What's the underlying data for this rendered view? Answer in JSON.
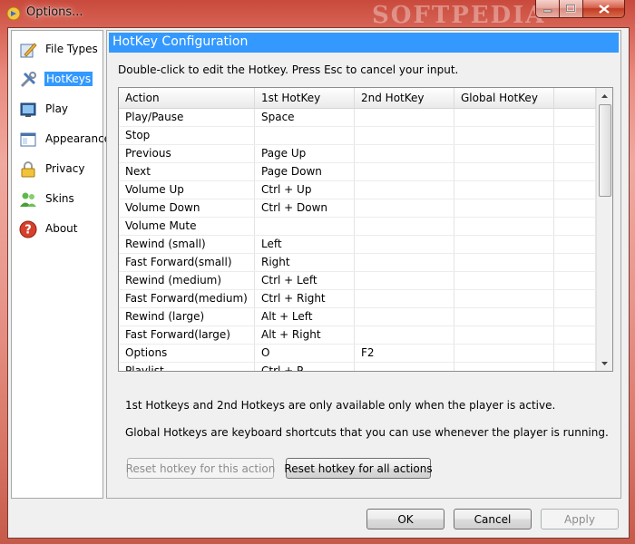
{
  "window": {
    "title": "Options...",
    "watermark": "SOFTPEDIA",
    "controls": {
      "minimize": "–",
      "maximize": "□",
      "close": "✕"
    }
  },
  "sidebar": {
    "items": [
      {
        "label": "File Types",
        "icon": "file-types-icon"
      },
      {
        "label": "HotKeys",
        "icon": "hotkeys-icon",
        "selected": true
      },
      {
        "label": "Play",
        "icon": "play-icon"
      },
      {
        "label": "Appearance",
        "icon": "appearance-icon"
      },
      {
        "label": "Privacy",
        "icon": "lock-icon"
      },
      {
        "label": "Skins",
        "icon": "skins-icon"
      },
      {
        "label": "About",
        "icon": "help-icon"
      }
    ]
  },
  "main": {
    "header": "HotKey Configuration",
    "instruction": "Double-click to edit the Hotkey. Press Esc to cancel your input.",
    "table": {
      "columns": [
        "Action",
        "1st HotKey",
        "2nd HotKey",
        "Global HotKey"
      ],
      "rows": [
        [
          "Play/Pause",
          "Space",
          "",
          ""
        ],
        [
          "Stop",
          "",
          "",
          ""
        ],
        [
          "Previous",
          "Page Up",
          "",
          ""
        ],
        [
          "Next",
          "Page Down",
          "",
          ""
        ],
        [
          "Volume Up",
          "Ctrl + Up",
          "",
          ""
        ],
        [
          "Volume Down",
          "Ctrl + Down",
          "",
          ""
        ],
        [
          "Volume Mute",
          "",
          "",
          ""
        ],
        [
          "Rewind (small)",
          "Left",
          "",
          ""
        ],
        [
          "Fast Forward(small)",
          "Right",
          "",
          ""
        ],
        [
          "Rewind (medium)",
          "Ctrl + Left",
          "",
          ""
        ],
        [
          "Fast Forward(medium)",
          "Ctrl + Right",
          "",
          ""
        ],
        [
          "Rewind (large)",
          "Alt + Left",
          "",
          ""
        ],
        [
          "Fast Forward(large)",
          "Alt + Right",
          "",
          ""
        ],
        [
          "Options",
          "O",
          "F2",
          ""
        ],
        [
          "Playlist",
          "Ctrl + P",
          "",
          ""
        ]
      ]
    },
    "note1": "1st Hotkeys and 2nd Hotkeys are only available only when the player is active.",
    "note2": "Global Hotkeys are keyboard shortcuts that you can use whenever the player is running.",
    "reset_this_label": "Reset hotkey for this action",
    "reset_all_label": "Reset hotkey for all actions"
  },
  "footer": {
    "ok_label": "OK",
    "cancel_label": "Cancel",
    "apply_label": "Apply"
  },
  "colors": {
    "selection": "#3399ff",
    "frame": "#d9685a"
  }
}
